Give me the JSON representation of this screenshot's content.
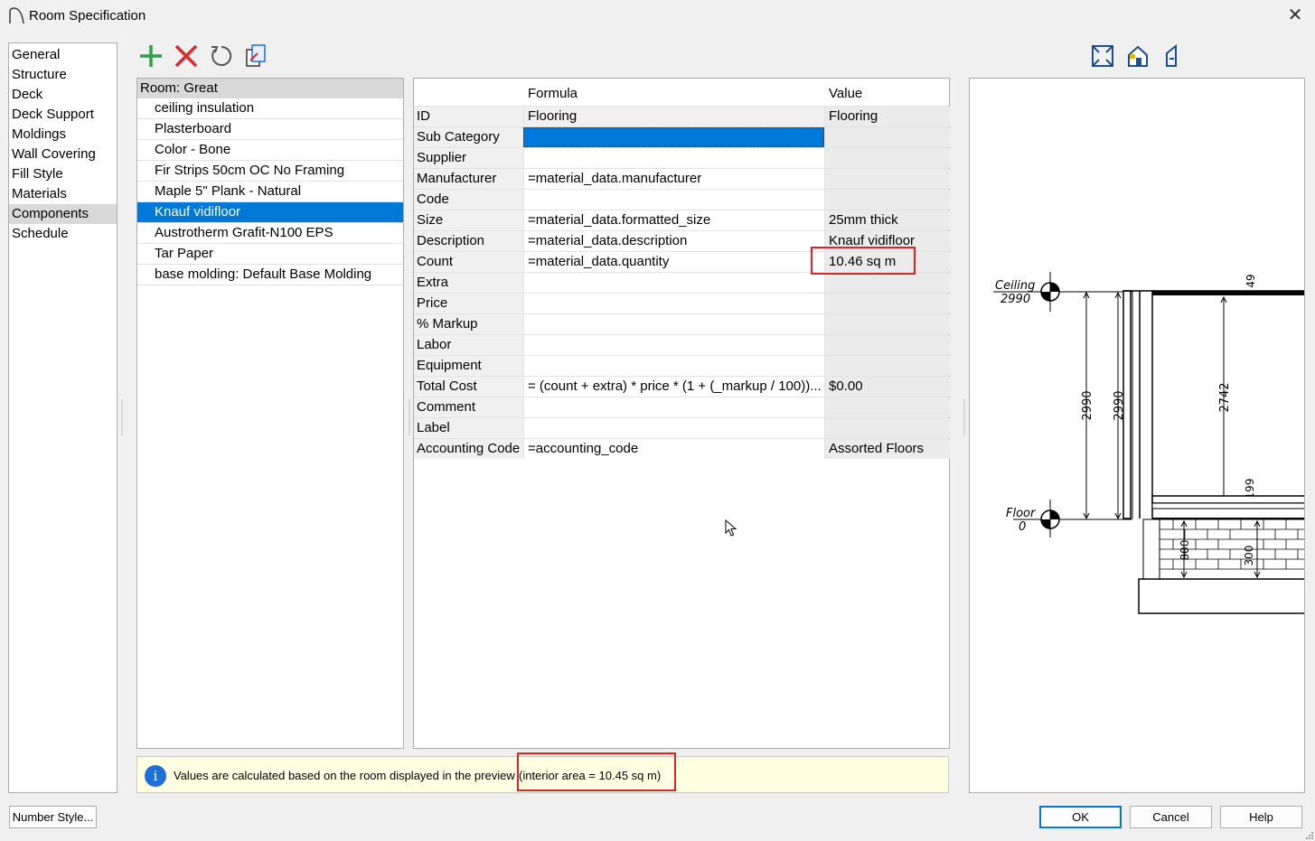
{
  "window": {
    "title": "Room Specification"
  },
  "categories": [
    {
      "label": "General",
      "selected": false
    },
    {
      "label": "Structure",
      "selected": false
    },
    {
      "label": "Deck",
      "selected": false
    },
    {
      "label": "Deck Support",
      "selected": false
    },
    {
      "label": "Moldings",
      "selected": false
    },
    {
      "label": "Wall Covering",
      "selected": false
    },
    {
      "label": "Fill Style",
      "selected": false
    },
    {
      "label": "Materials",
      "selected": false
    },
    {
      "label": "Components",
      "selected": true
    },
    {
      "label": "Schedule",
      "selected": false
    }
  ],
  "toolbar": {
    "icons": [
      "add-icon",
      "delete-icon",
      "reset-icon",
      "component-edit-icon"
    ]
  },
  "components": {
    "header": "Room: Great",
    "items": [
      {
        "label": "ceiling insulation",
        "selected": false
      },
      {
        "label": "Plasterboard",
        "selected": false
      },
      {
        "label": "Color - Bone",
        "selected": false
      },
      {
        "label": "Fir Strips 50cm OC No Framing",
        "selected": false
      },
      {
        "label": "Maple 5\" Plank - Natural",
        "selected": false
      },
      {
        "label": "Knauf vidifloor",
        "selected": true
      },
      {
        "label": "Austrotherm Grafit-N100 EPS",
        "selected": false
      },
      {
        "label": "Tar Paper",
        "selected": false
      },
      {
        "label": "base molding: Default Base Molding",
        "selected": false
      }
    ]
  },
  "grid": {
    "columns": {
      "formula": "Formula",
      "value": "Value"
    },
    "rows": [
      {
        "label": "ID",
        "formula": "Flooring",
        "value": "Flooring",
        "readonly": true
      },
      {
        "label": "Sub Category",
        "formula": "",
        "value": "",
        "selected": true
      },
      {
        "label": "Supplier",
        "formula": "",
        "value": ""
      },
      {
        "label": "Manufacturer",
        "formula": "=material_data.manufacturer",
        "value": ""
      },
      {
        "label": "Code",
        "formula": "",
        "value": ""
      },
      {
        "label": "Size",
        "formula": "=material_data.formatted_size",
        "value": "25mm thick"
      },
      {
        "label": "Description",
        "formula": "=material_data.description",
        "value": "Knauf vidifloor"
      },
      {
        "label": "Count",
        "formula": "=material_data.quantity",
        "value": "10.46 sq m"
      },
      {
        "label": "Extra",
        "formula": "",
        "value": ""
      },
      {
        "label": "Price",
        "formula": "",
        "value": ""
      },
      {
        "label": "% Markup",
        "formula": "",
        "value": ""
      },
      {
        "label": "Labor",
        "formula": "",
        "value": ""
      },
      {
        "label": "Equipment",
        "formula": "",
        "value": ""
      },
      {
        "label": "Total Cost",
        "formula": "= (count + extra) * price * (1 + (_markup / 100))...",
        "value": "$0.00"
      },
      {
        "label": "Comment",
        "formula": "",
        "value": ""
      },
      {
        "label": "Label",
        "formula": "",
        "value": ""
      },
      {
        "label": "Accounting Code",
        "formula": "=accounting_code",
        "value": "Assorted Floors"
      }
    ]
  },
  "preview": {
    "ceiling_label": "Ceiling",
    "ceiling_value": "2990",
    "floor_label": "Floor",
    "floor_value": "0",
    "dims": {
      "top": "49",
      "left_outer": "2990",
      "left_inner": "2990",
      "center": "2742",
      "lower": "199",
      "base_left": "800",
      "base_right": "300"
    },
    "view_icons": [
      "fill-window-icon",
      "camera-view-icon",
      "elevation-view-icon"
    ]
  },
  "info": {
    "message": "Values are calculated based on the room displayed in the preview",
    "area": "(interior area = 10.45 sq m)"
  },
  "buttons": {
    "number_style": "Number Style...",
    "ok": "OK",
    "cancel": "Cancel",
    "help": "Help"
  }
}
